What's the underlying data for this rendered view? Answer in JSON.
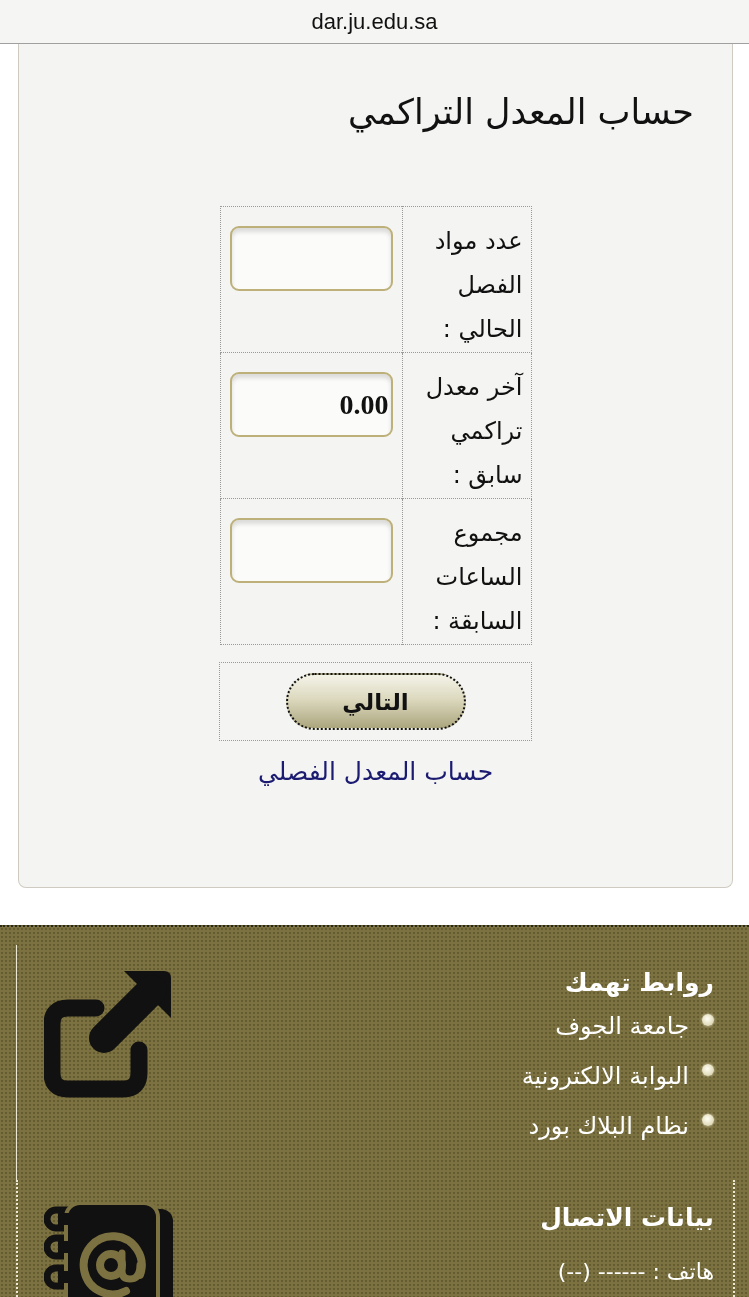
{
  "browser": {
    "url": "dar.ju.edu.sa"
  },
  "form": {
    "title": "حساب المعدل التراكمي",
    "fields": [
      {
        "label": "عدد مواد الفصل الحالي :"
      },
      {
        "label": "آخر معدل تراكمي سابق :",
        "value": "0.00"
      },
      {
        "label": "مجموع الساعات السابقة :"
      }
    ],
    "submit": "التالي",
    "link": "حساب المعدل الفصلي"
  },
  "footer": {
    "sections": [
      {
        "kind": "links",
        "heading": "روابط تهمك",
        "items": [
          "جامعة الجوف",
          "البوابة الالكترونية",
          "نظام البلاك بورد"
        ]
      },
      {
        "kind": "contact",
        "heading": "بيانات الاتصال",
        "lines": [
          "هاتف : ------ (--)"
        ]
      }
    ]
  }
}
